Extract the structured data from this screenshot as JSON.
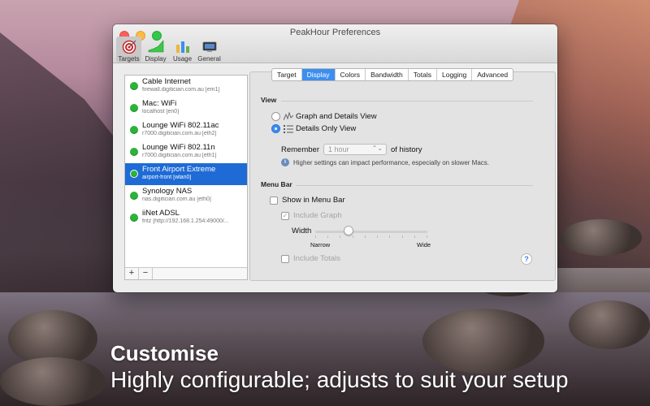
{
  "window": {
    "title": "PeakHour Preferences"
  },
  "toolbar": {
    "items": [
      {
        "label": "Targets",
        "icon": "target-icon"
      },
      {
        "label": "Display",
        "icon": "display-graph-icon"
      },
      {
        "label": "Usage",
        "icon": "usage-bars-icon"
      },
      {
        "label": "General",
        "icon": "general-screen-icon"
      }
    ],
    "selected": "Targets"
  },
  "sidebar": {
    "hosts": [
      {
        "name": "Cable Internet",
        "addr": "firewall.digitician.com.au [em1]",
        "status": "green"
      },
      {
        "name": "Mac: WiFi",
        "addr": "localhost [en0]",
        "status": "green"
      },
      {
        "name": "Lounge WiFi 802.11ac",
        "addr": "r7000.digitician.com.au [eth2]",
        "status": "green"
      },
      {
        "name": "Lounge WiFi 802.11n",
        "addr": "r7000.digitician.com.au [eth1]",
        "status": "green"
      },
      {
        "name": "Front Airport Extreme",
        "addr": "airport-front [wlan0]",
        "status": "green"
      },
      {
        "name": "Synology NAS",
        "addr": "nas.digitician.com.au [eth0]",
        "status": "green"
      },
      {
        "name": "iiNet ADSL",
        "addr": "fritz [http://192.168.1.254:49000/...",
        "status": "green"
      }
    ],
    "selected_index": 4,
    "add_label": "+",
    "remove_label": "−"
  },
  "tabs": [
    "Target",
    "Display",
    "Colors",
    "Bandwidth",
    "Totals",
    "Logging",
    "Advanced"
  ],
  "active_tab": "Display",
  "view_section": {
    "title": "View",
    "option_graph": "Graph and Details View",
    "option_details": "Details Only View",
    "selected": "Details Only View",
    "remember_label": "Remember",
    "remember_value": "1 hour",
    "history_label": "of history",
    "info_text": "Higher settings can impact performance, especially on slower Macs."
  },
  "menubar_section": {
    "title": "Menu Bar",
    "show_label": "Show in Menu Bar",
    "show_checked": false,
    "include_graph_label": "Include Graph",
    "include_graph_checked": true,
    "width_label": "Width",
    "narrow_label": "Narrow",
    "wide_label": "Wide",
    "width_value": 0.3,
    "include_totals_label": "Include Totals",
    "include_totals_checked": false
  },
  "help_label": "?",
  "captions": {
    "headline": "Customise",
    "subline": "Highly configurable; adjusts to suit your setup"
  }
}
